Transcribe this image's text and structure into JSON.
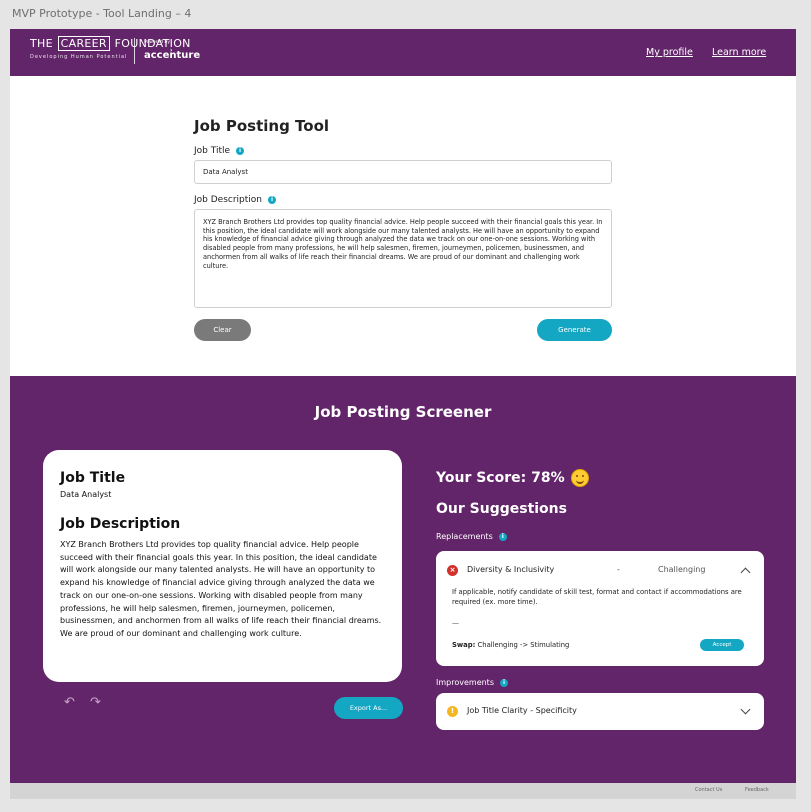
{
  "frame_label": "MVP Prototype - Tool Landing – 4",
  "header": {
    "logo_title_part1": "THE",
    "logo_title_part2": "CAREER",
    "logo_title_part3": "FOUNDATION",
    "logo_subtitle": "Developing Human Potential",
    "powered_by": "Powered by",
    "partner": "accenture",
    "nav": {
      "profile": "My profile",
      "learn_more": "Learn more"
    }
  },
  "tool": {
    "title": "Job Posting Tool",
    "job_title_label": "Job Title",
    "job_title_value": "Data Analyst",
    "job_description_label": "Job Description",
    "job_description_value": "XYZ Branch Brothers Ltd provides top quality financial advice. Help people succeed with their financial goals this year. In this position, the ideal candidate will work alongside our many talented analysts. He will have an opportunity to expand his knowledge of financial advice giving through analyzed the data we track on our one-on-one sessions. Working with disabled people from many professions, he will help salesmen, firemen, journeymen, policemen, businessmen, and anchormen from all walks of life reach their financial dreams. We are proud of our dominant and challenging work culture.",
    "clear_label": "Clear",
    "generate_label": "Generate"
  },
  "screener": {
    "title": "Job Posting Screener",
    "preview": {
      "job_title_heading": "Job Title",
      "job_title_value": "Data Analyst",
      "job_description_heading": "Job Description",
      "job_description_value": "XYZ Branch Brothers Ltd provides top quality financial advice. Help people succeed with their financial goals this year. In this position, the ideal candidate will work alongside our many talented analysts. He will have an opportunity to expand his knowledge of financial advice giving through analyzed the data we track on our one-on-one sessions. Working with disabled people from many professions, he will help salesmen, firemen, journeymen, policemen, businessmen, and anchormen from all walks of life reach their financial dreams. We are proud of our dominant and challenging work culture."
    },
    "export_label": "Export As...",
    "score_label": "Your Score: 78%",
    "suggestions_title": "Our Suggestions",
    "replacements_label": "Replacements",
    "replacement": {
      "name": "Diversity & Inclusivity",
      "dash": "-",
      "level": "Challenging",
      "body": "If applicable, notify candidate of skill test, format and contact if accommodations are required (ex. more time).",
      "separator": "—",
      "swap_label": "Swap:",
      "swap_value": "Challenging -> Stimulating",
      "accept_label": "Accept"
    },
    "improvements_label": "Improvements",
    "improvement": {
      "name": "Job Title Clarity - Specificity"
    }
  },
  "footer": {
    "contact": "Contact Us",
    "feedback": "Feedback"
  },
  "icons": [
    "info-icon",
    "close-circle-icon",
    "warning-circle-icon",
    "chevron-up-icon",
    "chevron-down-icon",
    "undo-icon",
    "redo-icon",
    "smiley-icon"
  ],
  "colors": {
    "brand_purple": "#632569",
    "accent_teal": "#13a7c3",
    "error_red": "#d0312d",
    "warning_yellow": "#f4b722"
  }
}
